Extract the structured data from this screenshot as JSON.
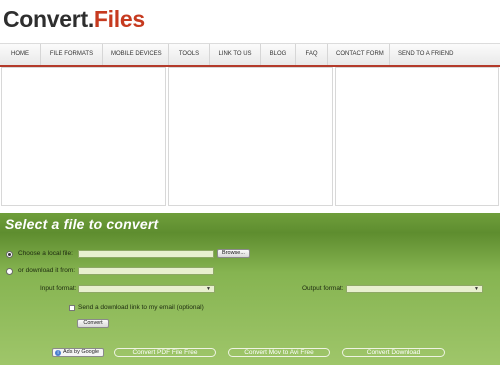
{
  "logo": {
    "part1": "Convert",
    "dot": ".",
    "part2": "Files"
  },
  "nav": {
    "items": [
      "HOME",
      "FILE FORMATS",
      "MOBILE DEVICES",
      "TOOLS",
      "LINK TO US",
      "BLOG",
      "FAQ",
      "CONTACT FORM",
      "SEND TO A FRIEND"
    ]
  },
  "converter": {
    "title": "Select a file to convert",
    "local_file_label": "Choose a local file:",
    "browse_label": "Browse...",
    "download_label": "or download it from:",
    "input_format_label": "Input format:",
    "output_format_label": "Output format:",
    "email_label": "Send a download link to my email (optional)",
    "convert_label": "Convert",
    "local_file_selected": true
  },
  "bottom_links": {
    "ads_by_google": "Ads by Google",
    "link1": "Convert PDF File Free",
    "link2": "Convert Mov to Avi Free",
    "link3": "Convert Download"
  },
  "colors": {
    "accent": "#c63a1f",
    "panel_green": "#6f9e3b",
    "nav_border": "#b33a2a"
  },
  "icons": {
    "dropdown": "chevron-down-icon",
    "ads_info": "info-icon"
  }
}
